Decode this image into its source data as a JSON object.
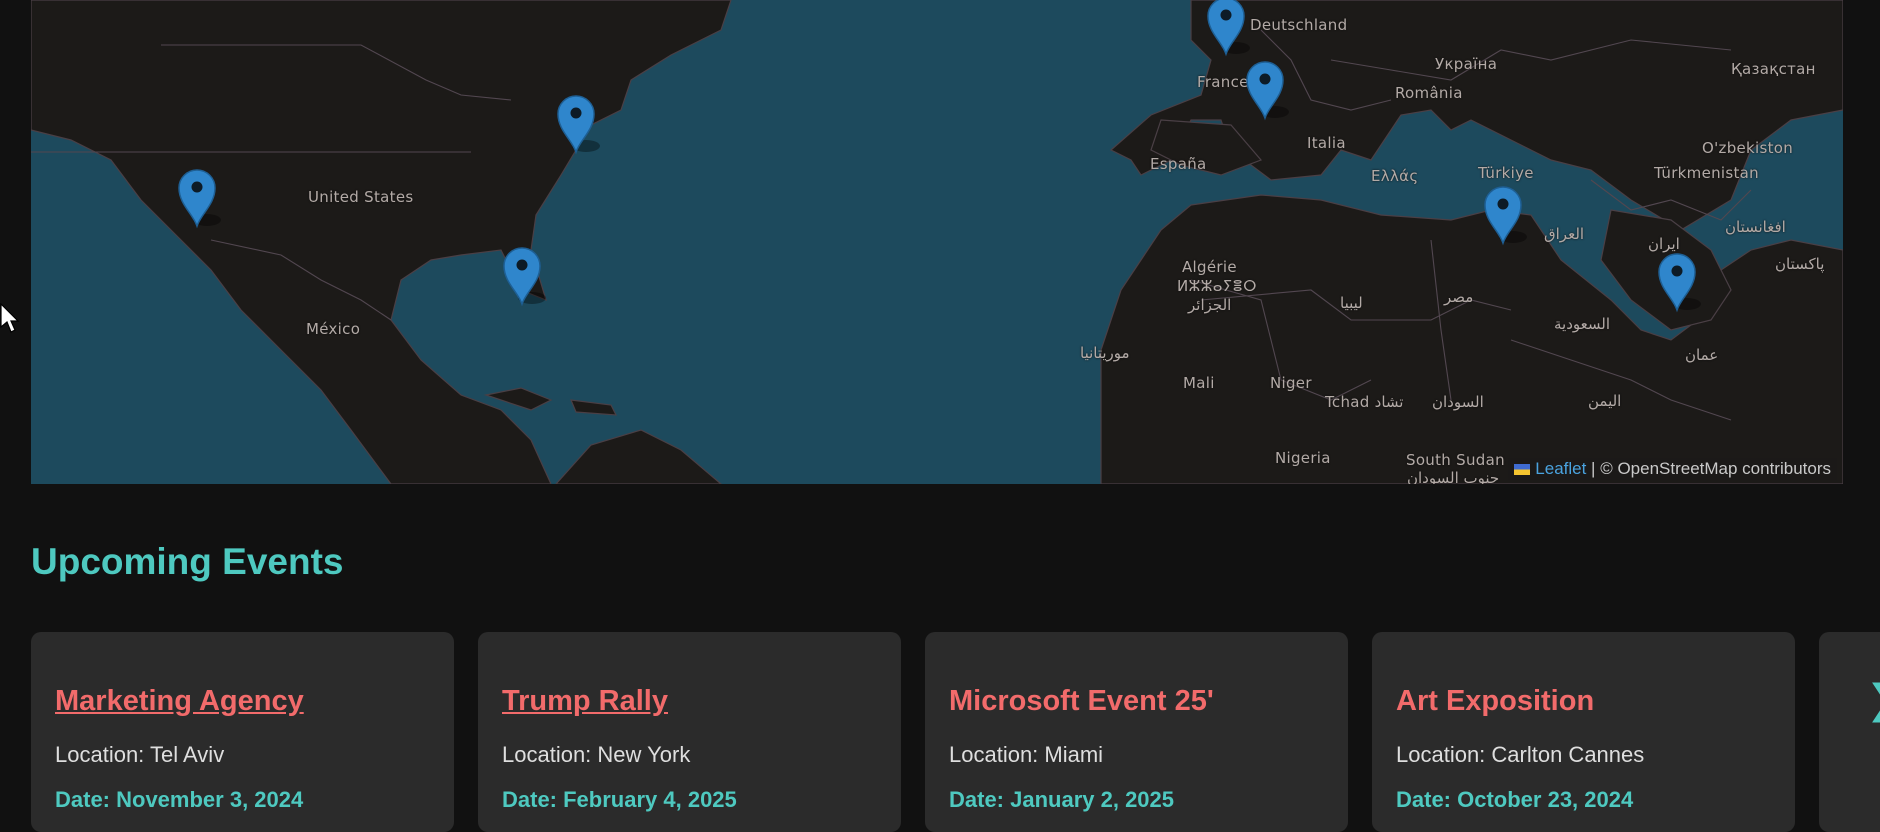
{
  "map": {
    "labels": {
      "deutschland": "Deutschland",
      "ukraina": "Україна",
      "kazakhstan": "Қазақстан",
      "france": "France",
      "romania": "România",
      "italia": "Italia",
      "espana": "España",
      "ellas": "Ελλάς",
      "turkiye": "Türkiye",
      "ozbekiston": "O'zbekiston",
      "turkmenistan": "Türkmenistan",
      "united_states": "United States",
      "iraq": "العراق",
      "iran": "ایران",
      "afghanistan": "افغانستان",
      "pakistan": "پاکستان",
      "algerie": "Algérie",
      "algerie_tifinagh": "ⵍⵣⵣⴰⵢⴻⵔ",
      "algerie_ar": "الجزائر",
      "libya": "ليبيا",
      "egypt": "مصر",
      "saudi": "السعودية",
      "mexico": "México",
      "mauritania": "موريتانيا",
      "mali": "Mali",
      "niger": "Niger",
      "tchad": "Tchad تشاد",
      "sudan": "السودان",
      "oman": "عمان",
      "yemen": "اليمن",
      "nigeria": "Nigeria",
      "south_sudan": "South Sudan",
      "south_sudan_ar": "جنوب السودان"
    },
    "markers": [
      {
        "name": "Los Angeles"
      },
      {
        "name": "New York"
      },
      {
        "name": "Miami"
      },
      {
        "name": "Paris"
      },
      {
        "name": "Cannes"
      },
      {
        "name": "Tel Aviv"
      },
      {
        "name": "Dubai"
      }
    ],
    "attribution": {
      "leaflet": "Leaflet",
      "separator": " | © OpenStreetMap contributors"
    }
  },
  "events": {
    "heading": "Upcoming Events",
    "cards": [
      {
        "title": "Marketing Agency",
        "location": "Location: Tel Aviv",
        "date": "Date: November 3, 2024"
      },
      {
        "title": "Trump Rally",
        "location": "Location: New York",
        "date": "Date: February 4, 2025"
      },
      {
        "title": "Microsoft Event 25'",
        "location": "Location: Miami",
        "date": "Date: January 2, 2025"
      },
      {
        "title": "Art Exposition",
        "location": "Location: Carlton Cannes",
        "date": "Date: October 23, 2024"
      }
    ],
    "next_icon": "chevron-right-icon"
  },
  "colors": {
    "ocean": "#1d4a5d",
    "land": "#1c1a18",
    "heading": "#4ec9c0",
    "card_title": "#f26b6b",
    "marker": "#2f86cc"
  }
}
